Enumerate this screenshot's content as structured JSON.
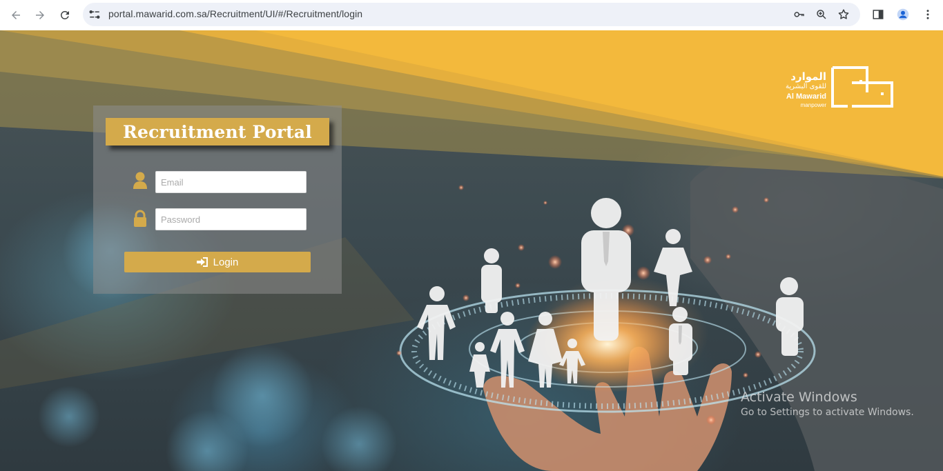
{
  "browser": {
    "url": "portal.mawarid.com.sa/Recruitment/UI/#/Recruitment/login",
    "icons": [
      "back-arrow-icon",
      "forward-arrow-icon",
      "reload-icon",
      "site-info-icon",
      "password-key-icon",
      "zoom-icon",
      "bookmark-star-icon",
      "side-panel-icon",
      "profile-icon",
      "more-menu-icon"
    ]
  },
  "logo": {
    "arabic_name": "الموارد",
    "arabic_sub": "للقوى البشرية",
    "english_name": "Al Mawarid",
    "english_sub": "manpower"
  },
  "login": {
    "title": "Recruitment Portal",
    "email_placeholder": "Email",
    "password_placeholder": "Password",
    "button_label": "Login",
    "icons": [
      "user-icon",
      "lock-icon",
      "sign-in-icon"
    ]
  },
  "watermark": {
    "line1": "Activate Windows",
    "line2": "Go to Settings to activate Windows."
  },
  "colors": {
    "accent_gold": "#d4aa4b",
    "banner_yellow": "#f3b93c",
    "omnibox_bg": "#eef1f8"
  }
}
